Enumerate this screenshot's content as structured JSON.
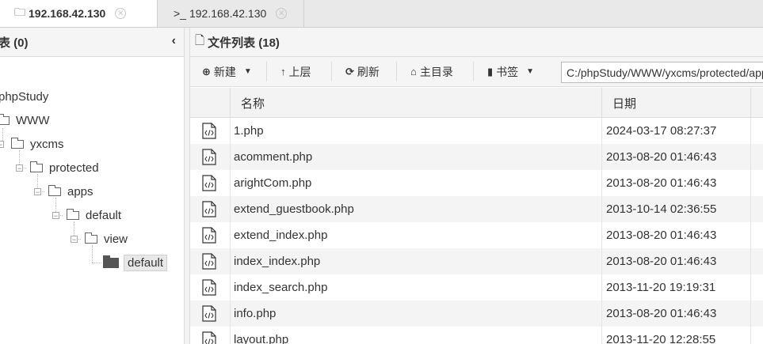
{
  "tabs": [
    {
      "icon": "folder-outline-icon",
      "lead": "🗀",
      "label": "192.168.42.130",
      "close": "✕"
    },
    {
      "icon": "terminal-icon",
      "lead": ">_",
      "label": "192.168.42.130",
      "close": "✕"
    }
  ],
  "left_panel": {
    "title": "表 (0)",
    "collapse": "‹",
    "tree": [
      {
        "label": "phpStudy"
      },
      {
        "label": "WWW"
      },
      {
        "label": "yxcms"
      },
      {
        "label": "protected"
      },
      {
        "label": "apps"
      },
      {
        "label": "default"
      },
      {
        "label": "view"
      },
      {
        "label": "default"
      }
    ]
  },
  "file_panel": {
    "title": "文件列表 (18)",
    "toolbar": {
      "new": "新建",
      "up": "上层",
      "refresh": "刷新",
      "home": "主目录",
      "bookmark": "书签"
    },
    "path": "C:/phpStudy/WWW/yxcms/protected/apps/default/view/default/",
    "columns": [
      "名称",
      "日期"
    ],
    "files": [
      {
        "name": "1.php",
        "date": "2024-03-17 08:27:37"
      },
      {
        "name": "acomment.php",
        "date": "2013-08-20 01:46:43"
      },
      {
        "name": "arightCom.php",
        "date": "2013-08-20 01:46:43"
      },
      {
        "name": "extend_guestbook.php",
        "date": "2013-10-14 02:36:55"
      },
      {
        "name": "extend_index.php",
        "date": "2013-08-20 01:46:43"
      },
      {
        "name": "index_index.php",
        "date": "2013-08-20 01:46:43"
      },
      {
        "name": "index_search.php",
        "date": "2013-11-20 19:19:31"
      },
      {
        "name": "info.php",
        "date": "2013-08-20 01:46:43"
      },
      {
        "name": "layout.php",
        "date": "2013-11-20 12:28:55"
      }
    ]
  }
}
